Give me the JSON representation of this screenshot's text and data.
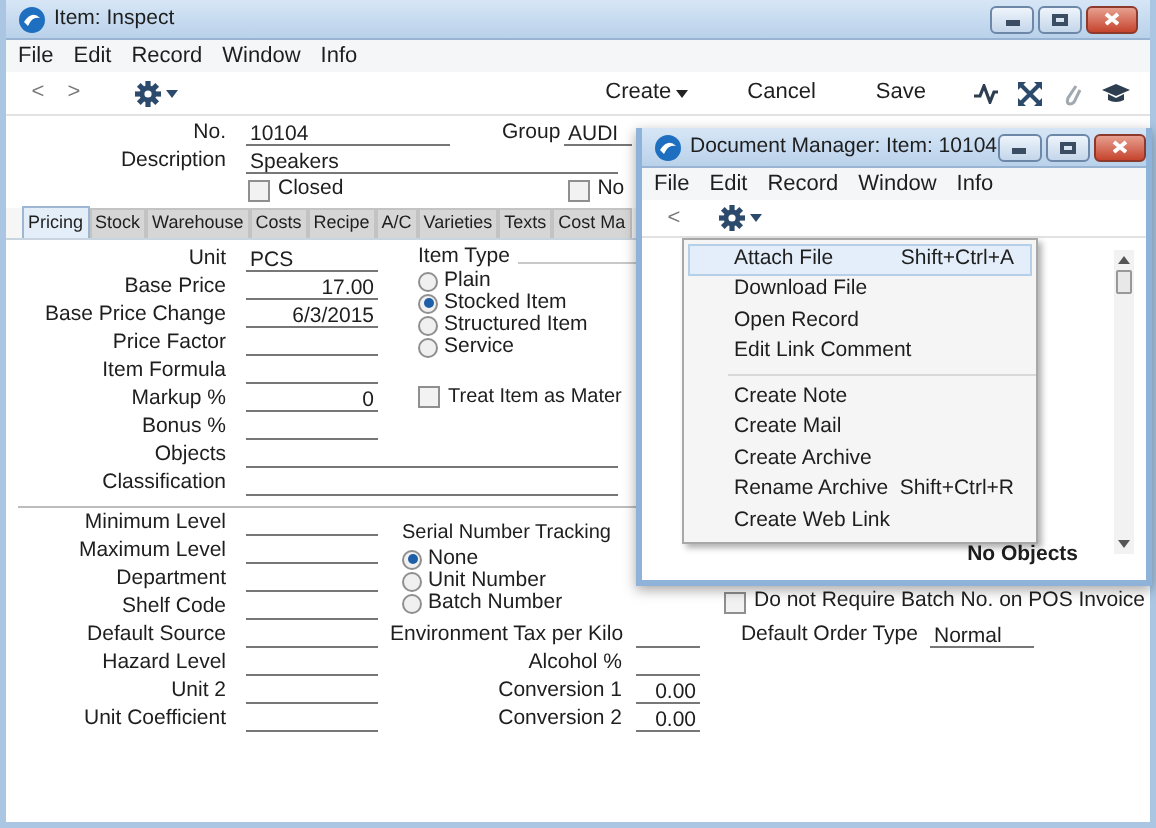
{
  "main_window": {
    "title": "Item: Inspect"
  },
  "menu": [
    "File",
    "Edit",
    "Record",
    "Window",
    "Info"
  ],
  "toolbar": {
    "back": "<",
    "forward": ">",
    "create": "Create",
    "buttons": [
      "Cancel",
      "Save"
    ]
  },
  "number": {
    "label": "No.",
    "value": "10104"
  },
  "group": {
    "label": "Group",
    "value": "AUDI"
  },
  "description": {
    "label": "Description",
    "value": "Speakers"
  },
  "header_checkboxes": [
    {
      "label": "Closed",
      "checked": false
    },
    {
      "label": "No",
      "checked": false
    }
  ],
  "tabs": [
    {
      "label": "Pricing",
      "selected": true
    },
    {
      "label": "Stock",
      "selected": false
    },
    {
      "label": "Warehouse",
      "selected": false
    },
    {
      "label": "Costs",
      "selected": false
    },
    {
      "label": "Recipe",
      "selected": false
    },
    {
      "label": "A/C",
      "selected": false
    },
    {
      "label": "Varieties",
      "selected": false
    },
    {
      "label": "Texts",
      "selected": false
    },
    {
      "label": "Cost Ma",
      "selected": false
    }
  ],
  "pricing_fields": [
    {
      "label": "Unit",
      "value": "PCS",
      "kind": "text"
    },
    {
      "label": "Base Price",
      "value": "17.00",
      "kind": "number"
    },
    {
      "label": "Base Price Change",
      "value": "6/3/2015",
      "kind": "number"
    },
    {
      "label": "Price Factor",
      "kind": "number"
    },
    {
      "label": "Item Formula",
      "kind": "text"
    },
    {
      "label": "Markup %",
      "value": "0",
      "kind": "number"
    },
    {
      "label": "Bonus %",
      "kind": "number"
    }
  ],
  "wide_fields": [
    {
      "label": "Objects"
    },
    {
      "label": "Classification"
    }
  ],
  "item_type": {
    "label": "Item Type",
    "options": [
      {
        "label": "Plain",
        "selected": false
      },
      {
        "label": "Stocked Item",
        "selected": true
      },
      {
        "label": "Structured Item",
        "selected": false
      },
      {
        "label": "Service",
        "selected": false
      }
    ]
  },
  "treat_as_material": {
    "label": "Treat Item as Mater",
    "checked": false
  },
  "level_fields": [
    {
      "label": "Minimum Level"
    },
    {
      "label": "Maximum Level"
    },
    {
      "label": "Department"
    },
    {
      "label": "Shelf Code"
    },
    {
      "label": "Default Source"
    },
    {
      "label": "Hazard Level"
    },
    {
      "label": "Unit 2"
    },
    {
      "label": "Unit Coefficient"
    }
  ],
  "serial_tracking": {
    "label": "Serial Number Tracking",
    "options": [
      {
        "label": "None",
        "selected": true
      },
      {
        "label": "Unit Number",
        "selected": false
      },
      {
        "label": "Batch Number",
        "selected": false
      }
    ]
  },
  "batch_checkbox": {
    "label": "Do not Require Batch No. on POS Invoice",
    "checked": false
  },
  "measure_fields": [
    {
      "label": "Environment Tax per Kilo"
    },
    {
      "label": "Alcohol %"
    },
    {
      "label": "Conversion 1",
      "value": "0.00"
    },
    {
      "label": "Conversion 2",
      "value": "0.00"
    }
  ],
  "default_order_type": {
    "label": "Default Order Type",
    "value": "Normal"
  },
  "doc_manager": {
    "title": "Document Manager: Item: 10104",
    "menu": [
      "File",
      "Edit",
      "Record",
      "Window",
      "Info"
    ],
    "back": "<",
    "status": "No Objects",
    "context_menu": [
      {
        "items": [
          {
            "label": "Attach File",
            "shortcut": "Shift+Ctrl+A",
            "selected": true
          },
          {
            "label": "Download File",
            "selected": false
          },
          {
            "label": "Open Record",
            "selected": false
          },
          {
            "label": "Edit Link Comment",
            "selected": false
          }
        ]
      },
      {
        "items": [
          {
            "label": "Create Note",
            "selected": false
          },
          {
            "label": "Create Mail",
            "selected": false
          },
          {
            "label": "Create Archive",
            "selected": false
          },
          {
            "label": "Rename Archive",
            "shortcut": "Shift+Ctrl+R",
            "selected": false
          },
          {
            "label": "Create Web Link",
            "selected": false
          }
        ]
      }
    ]
  }
}
